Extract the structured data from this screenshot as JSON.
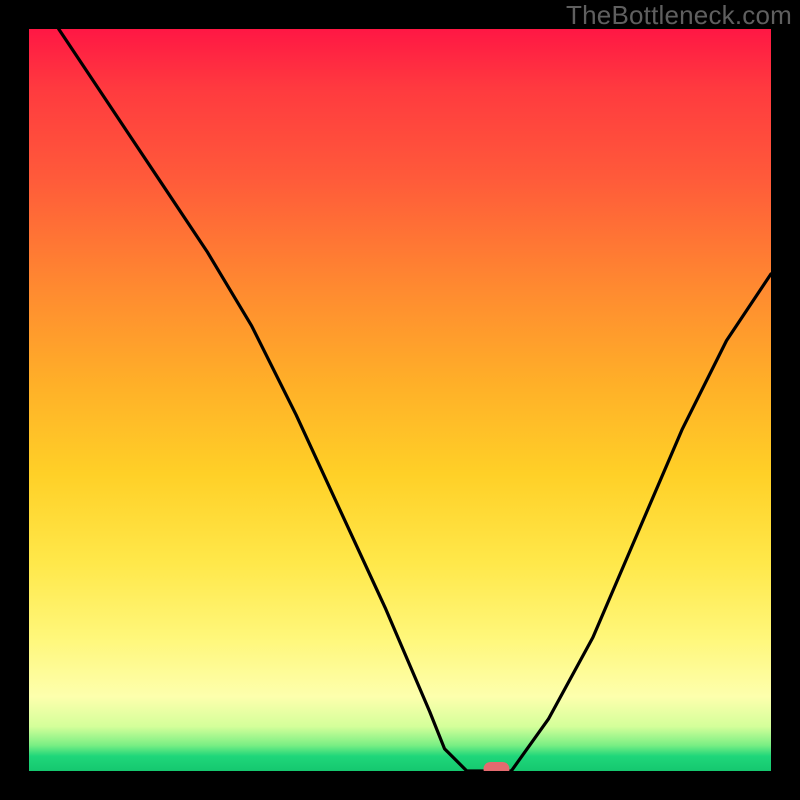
{
  "watermark": "TheBottleneck.com",
  "chart_data": {
    "type": "line",
    "title": "",
    "xlabel": "",
    "ylabel": "",
    "xlim": [
      0,
      100
    ],
    "ylim": [
      0,
      100
    ],
    "series": [
      {
        "name": "bottleneck-curve",
        "x": [
          4,
          10,
          18,
          24,
          30,
          36,
          42,
          48,
          54,
          56,
          59,
          62,
          65,
          70,
          76,
          82,
          88,
          94,
          100
        ],
        "y": [
          100,
          91,
          79,
          70,
          60,
          48,
          35,
          22,
          8,
          3,
          0,
          0,
          0,
          7,
          18,
          32,
          46,
          58,
          67
        ]
      }
    ],
    "marker": {
      "x": 63,
      "y": 0,
      "shape": "pill",
      "color": "#e46a6f"
    },
    "background_gradient": {
      "direction": "vertical",
      "stops": [
        {
          "pos": 0.0,
          "color": "#ff1744"
        },
        {
          "pos": 0.35,
          "color": "#ff8a30"
        },
        {
          "pos": 0.6,
          "color": "#ffd027"
        },
        {
          "pos": 0.9,
          "color": "#fdffad"
        },
        {
          "pos": 1.0,
          "color": "#15c86f"
        }
      ]
    }
  }
}
